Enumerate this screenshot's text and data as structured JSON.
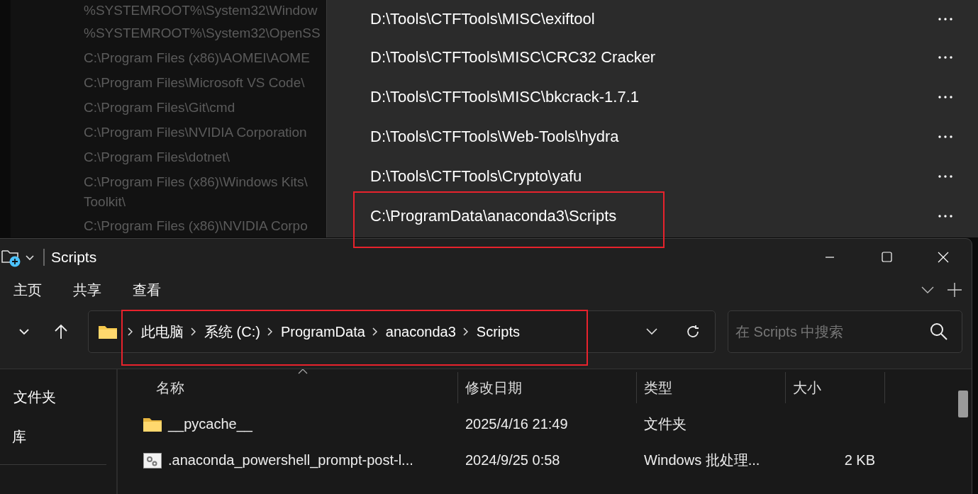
{
  "background_list": {
    "paths": [
      "%SYSTEMROOT%\\System32\\Window",
      "%SYSTEMROOT%\\System32\\OpenSS",
      "C:\\Program Files (x86)\\AOMEI\\AOME",
      "C:\\Program Files\\Microsoft VS Code\\",
      "C:\\Program Files\\Git\\cmd",
      "C:\\Program Files\\NVIDIA Corporation",
      "C:\\Program Files\\dotnet\\",
      "C:\\Program Files (x86)\\Windows Kits\\\nToolkit\\",
      "C:\\Program Files (x86)\\NVIDIA Corpo"
    ]
  },
  "path_list": {
    "items": [
      {
        "text": "D:\\Tools\\CTFTools\\MISC\\exiftool",
        "highlighted": false
      },
      {
        "text": "D:\\Tools\\CTFTools\\MISC\\CRC32 Cracker",
        "highlighted": false
      },
      {
        "text": "D:\\Tools\\CTFTools\\MISC\\bkcrack-1.7.1",
        "highlighted": false
      },
      {
        "text": "D:\\Tools\\CTFTools\\Web-Tools\\hydra",
        "highlighted": false
      },
      {
        "text": "D:\\Tools\\CTFTools\\Crypto\\yafu",
        "highlighted": false
      },
      {
        "text": "C:\\ProgramData\\anaconda3\\Scripts",
        "highlighted": true
      }
    ]
  },
  "explorer": {
    "title": "Scripts",
    "ribbon_tabs": [
      "主页",
      "共享",
      "查看"
    ],
    "address_bar": {
      "breadcrumbs": [
        "此电脑",
        "系统 (C:)",
        "ProgramData",
        "anaconda3",
        "Scripts"
      ],
      "highlighted": true
    },
    "search": {
      "placeholder": "在 Scripts 中搜索"
    },
    "sidebar": {
      "items": [
        "文件夹",
        "库"
      ]
    },
    "columns": [
      "名称",
      "修改日期",
      "类型",
      "大小"
    ],
    "rows": [
      {
        "kind": "folder",
        "name": "__pycache__",
        "modified": "2025/4/16 21:49",
        "type": "文件夹"
      },
      {
        "kind": "batch",
        "name": ".anaconda_powershell_prompt-post-l...",
        "modified": "2024/9/25 0:58",
        "type": "Windows 批处理...",
        "size": "2 KB"
      }
    ]
  }
}
